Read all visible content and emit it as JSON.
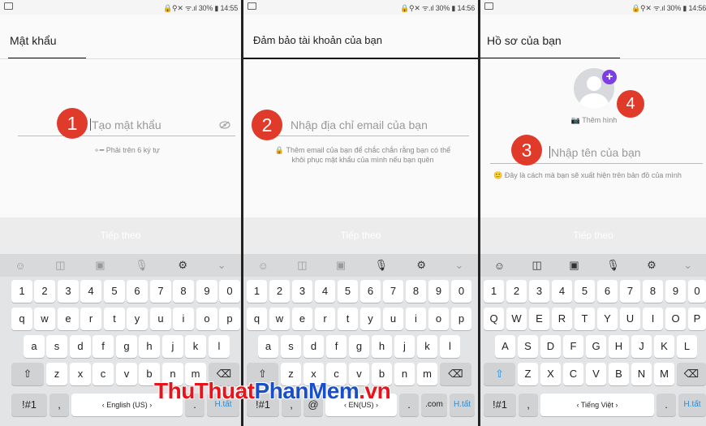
{
  "panel1": {
    "status_right": "🔒⚲✕ ᯤ.ıl 30% ▮ 14:55",
    "title": "Mật khẩu",
    "placeholder": "Tạo mật khẩu",
    "hint": "⚬━ Phải trên 6 ký tự",
    "badge": "1",
    "next": "Tiếp theo",
    "toolbar": [
      "☺",
      "◫",
      "▣",
      "🎙",
      "⚙",
      "⌄"
    ],
    "keys": {
      "row1": [
        "1",
        "2",
        "3",
        "4",
        "5",
        "6",
        "7",
        "8",
        "9",
        "0"
      ],
      "row2": [
        "q",
        "w",
        "e",
        "r",
        "t",
        "y",
        "u",
        "i",
        "o",
        "p"
      ],
      "row3": [
        "a",
        "s",
        "d",
        "f",
        "g",
        "h",
        "j",
        "k",
        "l"
      ],
      "row4": [
        "⇧",
        "z",
        "x",
        "c",
        "v",
        "b",
        "n",
        "m",
        "⌫"
      ],
      "sym": "!#1",
      "comma": ",",
      "space": "‹ English (US) ›",
      "period": ".",
      "action": "H.tất"
    }
  },
  "panel2": {
    "status_right": "🔒⚲✕ ᯤ.ıl 30% ▮ 14:56",
    "title": "Đảm bảo tài khoản của bạn",
    "placeholder": "Nhập địa chỉ email của bạn",
    "hint": "🔒 Thêm email của bạn để chắc chắn rằng bạn có thể khôi phục mật khẩu của mình nếu bạn quên",
    "badge": "2",
    "next": "Tiếp theo",
    "toolbar": [
      "☺",
      "◫",
      "▣",
      "🎙",
      "⚙",
      "⌄"
    ],
    "keys": {
      "row1": [
        "1",
        "2",
        "3",
        "4",
        "5",
        "6",
        "7",
        "8",
        "9",
        "0"
      ],
      "row2": [
        "q",
        "w",
        "e",
        "r",
        "t",
        "y",
        "u",
        "i",
        "o",
        "p"
      ],
      "row3": [
        "a",
        "s",
        "d",
        "f",
        "g",
        "h",
        "j",
        "k",
        "l"
      ],
      "row4": [
        "⇧",
        "z",
        "x",
        "c",
        "v",
        "b",
        "n",
        "m",
        "⌫"
      ],
      "sym": "!#1",
      "comma": ",",
      "at": "@",
      "space": "‹ EN(US) ›",
      "period": ".",
      "com": ".com",
      "action": "H.tất"
    }
  },
  "panel3": {
    "status_right": "🔒⚲✕ ᯤ.ıl 30% ▮ 14:56",
    "title": "Hồ sơ của bạn",
    "add_photo": "📷 Thêm hình",
    "placeholder": "Nhập tên của bạn",
    "hint": "🙂 Đây là cách mà bạn sẽ xuất hiện trên bản đồ của mình",
    "badge3": "3",
    "badge4": "4",
    "plus": "+",
    "next": "Tiếp theo",
    "toolbar": [
      "☺",
      "◫",
      "▣",
      "🎙",
      "⚙",
      "⌄"
    ],
    "keys": {
      "row1": [
        "1",
        "2",
        "3",
        "4",
        "5",
        "6",
        "7",
        "8",
        "9",
        "0"
      ],
      "row2": [
        "Q",
        "W",
        "E",
        "R",
        "T",
        "Y",
        "U",
        "I",
        "O",
        "P"
      ],
      "row3": [
        "A",
        "S",
        "D",
        "F",
        "G",
        "H",
        "J",
        "K",
        "L"
      ],
      "row4": [
        "⇧",
        "Z",
        "X",
        "C",
        "V",
        "B",
        "N",
        "M",
        "⌫"
      ],
      "sym": "!#1",
      "comma": ",",
      "space": "‹ Tiếng Việt ›",
      "period": ".",
      "action": "H.tất"
    }
  },
  "watermark": {
    "part1": "ThuThuat",
    "part2": "PhanMem",
    "part3": ".vn"
  },
  "colors": {
    "badge": "#e03b2a",
    "plus": "#7b3fe4",
    "action_key": "#2a8ed6",
    "watermark_red": "#e8141c",
    "watermark_blue": "#1a4fc8"
  }
}
